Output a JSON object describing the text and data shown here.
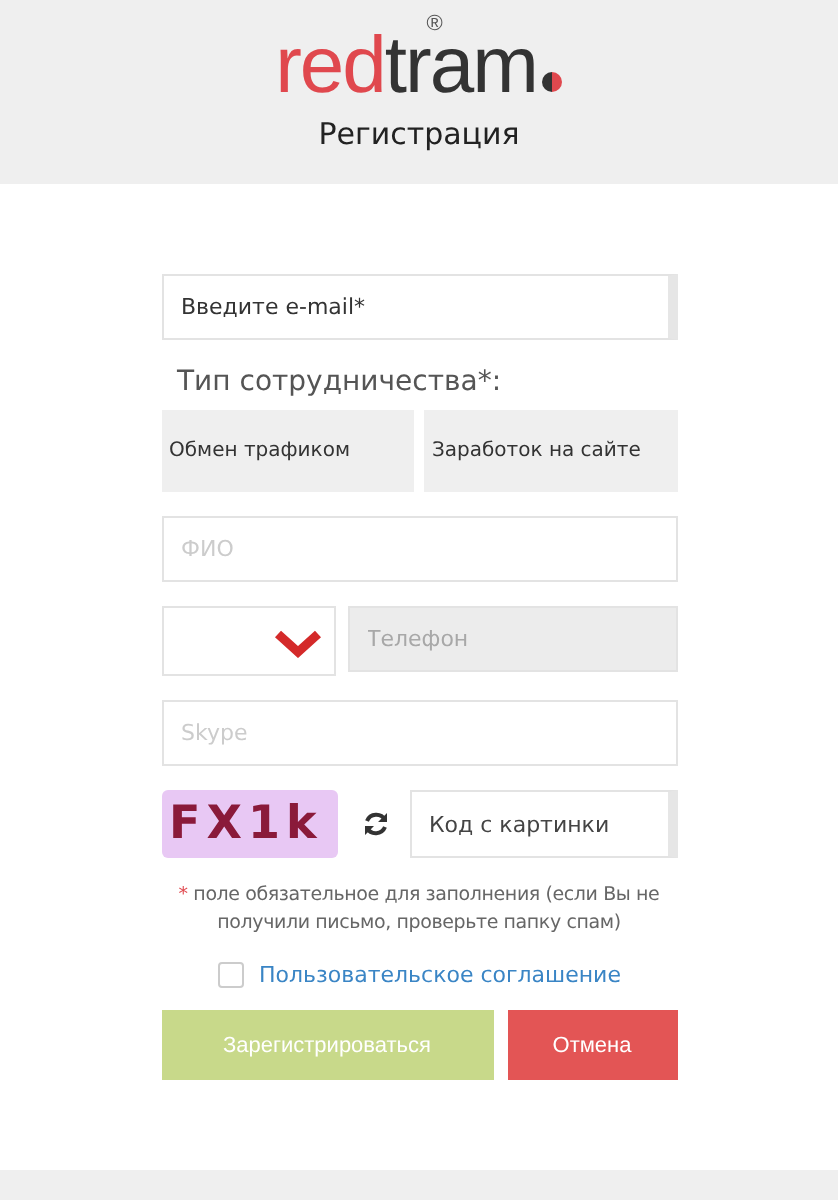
{
  "logo": {
    "part_1": "red",
    "part_2": "tram",
    "mark": "®"
  },
  "title": "Регистрация",
  "email": {
    "placeholder": "Введите e-mail*"
  },
  "type_label": "Тип сотрудничества*:",
  "types": [
    {
      "label": "Обмен трафиком",
      "selected": false
    },
    {
      "label": "Заработок на сайте",
      "selected": false
    }
  ],
  "name_field": {
    "placeholder": "ФИО"
  },
  "phone": {
    "placeholder": "Телефон",
    "disabled": true
  },
  "skype": {
    "placeholder": "Skype"
  },
  "captcha": {
    "code": "FX1k",
    "placeholder": "Код с картинки"
  },
  "note": {
    "mark": "*",
    "text": "поле обязательное для заполнения (если Вы не получили письмо, проверьте папку спам)"
  },
  "agreement": {
    "label": "Пользовательское соглашение",
    "checked": false
  },
  "buttons": [
    {
      "kind": "submit",
      "label": "Зарегистрироваться"
    },
    {
      "kind": "cancel",
      "label": "Отмена"
    }
  ]
}
